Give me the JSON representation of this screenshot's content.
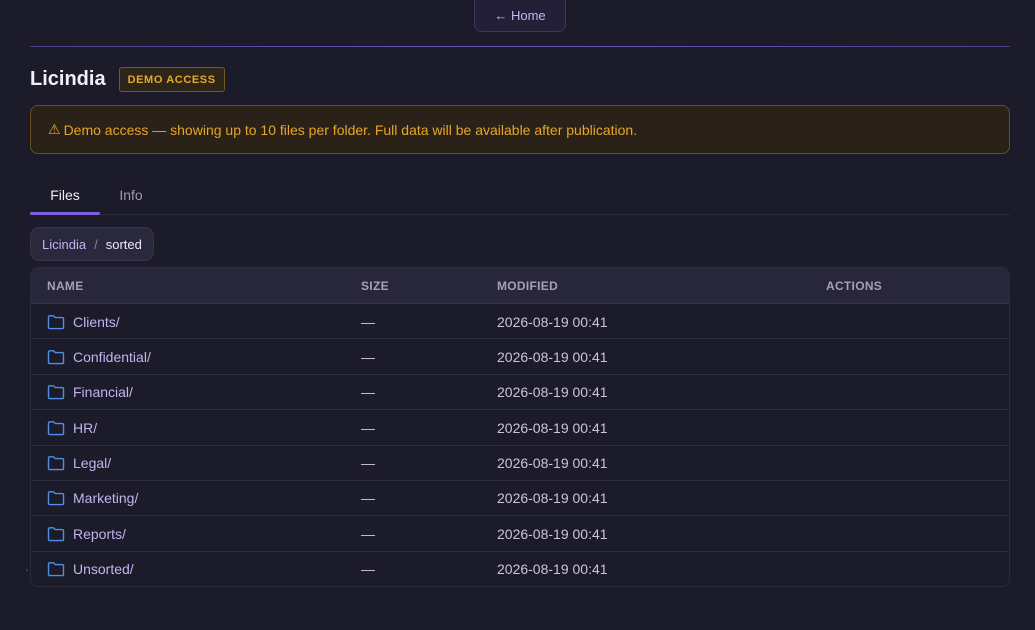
{
  "nav": {
    "home_label": "← Home"
  },
  "header": {
    "title": "Licindia",
    "badge": "DEMO ACCESS"
  },
  "alert": {
    "icon": "⚠",
    "text": "Demo access — showing up to 10 files per folder. Full data will be available after publication."
  },
  "tabs": [
    {
      "label": "Files",
      "active": true
    },
    {
      "label": "Info",
      "active": false
    }
  ],
  "breadcrumb": {
    "root": "Licindia",
    "separator": "/",
    "current": "sorted"
  },
  "table": {
    "columns": {
      "name": "NAME",
      "size": "SIZE",
      "modified": "MODIFIED",
      "actions": "ACTIONS"
    },
    "rows": [
      {
        "name": "Clients/",
        "size": "—",
        "modified": "2026-08-19 00:41",
        "icon": "folder-icon"
      },
      {
        "name": "Confidential/",
        "size": "—",
        "modified": "2026-08-19 00:41",
        "icon": "folder-icon"
      },
      {
        "name": "Financial/",
        "size": "—",
        "modified": "2026-08-19 00:41",
        "icon": "folder-icon"
      },
      {
        "name": "HR/",
        "size": "—",
        "modified": "2026-08-19 00:41",
        "icon": "folder-icon"
      },
      {
        "name": "Legal/",
        "size": "—",
        "modified": "2026-08-19 00:41",
        "icon": "folder-icon"
      },
      {
        "name": "Marketing/",
        "size": "—",
        "modified": "2026-08-19 00:41",
        "icon": "folder-icon"
      },
      {
        "name": "Reports/",
        "size": "—",
        "modified": "2026-08-19 00:41",
        "icon": "folder-icon"
      },
      {
        "name": "Unsorted/",
        "size": "—",
        "modified": "2026-08-19 00:41",
        "icon": "folder-icon"
      }
    ]
  },
  "colors": {
    "background": "#1c1b29",
    "accent": "#7f5ee0",
    "warning": "#e8a524",
    "folder_icon": "#4f8fe8"
  }
}
